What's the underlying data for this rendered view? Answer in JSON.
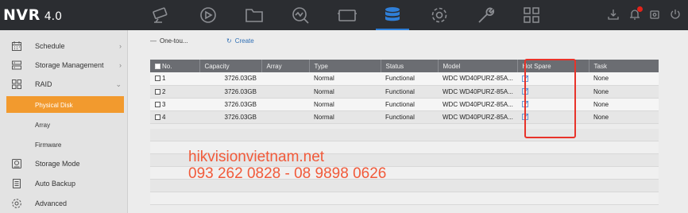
{
  "app": {
    "brand": "NVR",
    "version": "4.0",
    "accent_color": "#2f7fd8",
    "active_color": "#f29a2e"
  },
  "topnav": [
    {
      "icon": "live-view-icon"
    },
    {
      "icon": "playback-icon"
    },
    {
      "icon": "file-icon"
    },
    {
      "icon": "search-icon"
    },
    {
      "icon": "camera-icon"
    },
    {
      "icon": "storage-icon",
      "active": true
    },
    {
      "icon": "config-icon"
    },
    {
      "icon": "maintenance-icon"
    },
    {
      "icon": "grid-icon"
    }
  ],
  "sidebar": {
    "items": [
      {
        "label": "Schedule",
        "icon": "calendar-icon",
        "expandable": true
      },
      {
        "label": "Storage Management",
        "icon": "storage-management-icon",
        "expandable": true
      },
      {
        "label": "RAID",
        "icon": "raid-icon",
        "expanded": true
      }
    ],
    "raid_sub": [
      {
        "label": "Physical Disk",
        "active": true
      },
      {
        "label": "Array"
      },
      {
        "label": "Firmware"
      }
    ],
    "items_bottom": [
      {
        "label": "Storage Mode",
        "icon": "disk-icon"
      },
      {
        "label": "Auto Backup",
        "icon": "backup-icon"
      },
      {
        "label": "Advanced",
        "icon": "advanced-icon"
      }
    ]
  },
  "toolbar": {
    "one_touch": "One-tou...",
    "create": "Create"
  },
  "table": {
    "columns": [
      "No.",
      "Capacity",
      "Array",
      "Type",
      "Status",
      "Model",
      "Hot Spare",
      "Task"
    ],
    "rows": [
      {
        "no": "1",
        "capacity": "3726.03GB",
        "array": "",
        "type": "Normal",
        "status": "Functional",
        "model": "WDC WD40PURZ-85A...",
        "task": "None"
      },
      {
        "no": "2",
        "capacity": "3726.03GB",
        "array": "",
        "type": "Normal",
        "status": "Functional",
        "model": "WDC WD40PURZ-85A...",
        "task": "None"
      },
      {
        "no": "3",
        "capacity": "3726.03GB",
        "array": "",
        "type": "Normal",
        "status": "Functional",
        "model": "WDC WD40PURZ-85A...",
        "task": "None"
      },
      {
        "no": "4",
        "capacity": "3726.03GB",
        "array": "",
        "type": "Normal",
        "status": "Functional",
        "model": "WDC WD40PURZ-85A...",
        "task": "None"
      }
    ]
  },
  "watermark": {
    "site": "hikvisionvietnam.net",
    "phones": "093 262 0828 - 08 9898 0626",
    "color": "#f15a3a"
  }
}
